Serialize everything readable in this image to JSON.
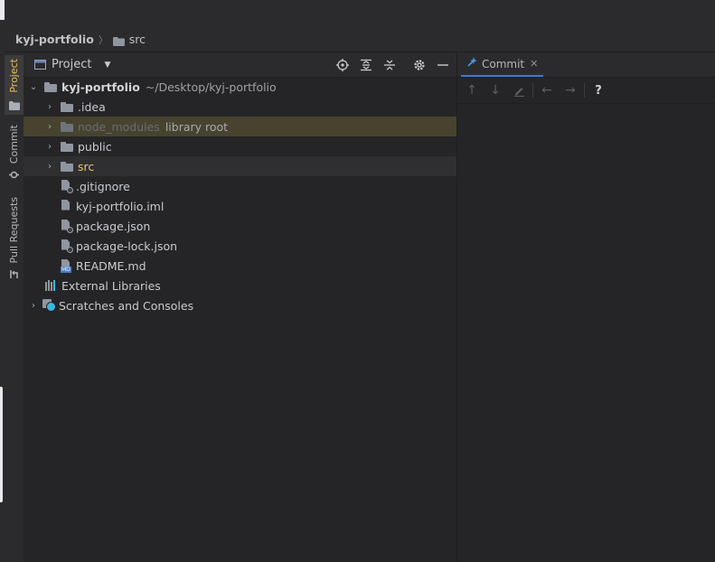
{
  "breadcrumb": {
    "root": "kyj-portfolio",
    "child": "src"
  },
  "side_tabs": [
    {
      "label": "Project",
      "active": true
    },
    {
      "label": "Commit",
      "active": false
    },
    {
      "label": "Pull Requests",
      "active": false
    }
  ],
  "project_panel": {
    "title": "Project",
    "tree": [
      {
        "label": "kyj-portfolio",
        "suffix": "~/Desktop/kyj-portfolio",
        "kind": "project-folder",
        "expanded": true
      },
      {
        "label": ".idea",
        "kind": "folder",
        "expanded": false
      },
      {
        "label": "node_modules",
        "suffix": "library root",
        "kind": "folder",
        "expanded": false
      },
      {
        "label": "public",
        "kind": "folder",
        "expanded": false
      },
      {
        "label": "src",
        "kind": "folder",
        "expanded": false
      },
      {
        "label": ".gitignore",
        "kind": "file"
      },
      {
        "label": "kyj-portfolio.iml",
        "kind": "file"
      },
      {
        "label": "package.json",
        "kind": "file"
      },
      {
        "label": "package-lock.json",
        "kind": "file"
      },
      {
        "label": "README.md",
        "kind": "file"
      },
      {
        "label": "External Libraries",
        "kind": "libraries"
      },
      {
        "label": "Scratches and Consoles",
        "kind": "scratches",
        "expanded": false
      }
    ]
  },
  "commit_panel": {
    "tab_label": "Commit",
    "toolbar_help": "?"
  },
  "colors": {
    "accent_active_tab": "#e6c15a",
    "src_highlight": "#e8c75f",
    "library_row": "#47432f",
    "commit_icon": "#4e94e8"
  }
}
